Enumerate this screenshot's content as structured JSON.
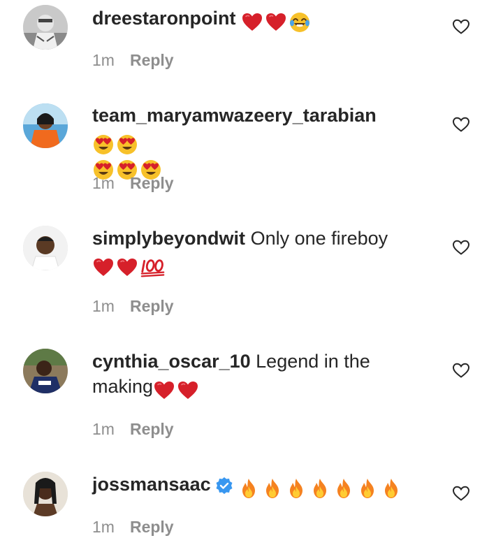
{
  "comments": [
    {
      "username": "dreestaronpoint",
      "text": "",
      "emojis": [
        "heart",
        "heart",
        "joy"
      ],
      "time": "1m",
      "reply": "Reply"
    },
    {
      "username": "team_maryamwazeery_tarabian",
      "text": "",
      "emojis": [
        "heart-eyes",
        "heart-eyes",
        "heart-eyes",
        "heart-eyes",
        "heart-eyes"
      ],
      "time": "1m",
      "reply": "Reply"
    },
    {
      "username": "simplybeyondwit",
      "text": "Only one fireboy",
      "emojis": [
        "heart",
        "heart",
        "hundred"
      ],
      "time": "1m",
      "reply": "Reply"
    },
    {
      "username": "cynthia_oscar_10",
      "text": "Legend in the",
      "text2": "making",
      "emojis": [
        "heart",
        "heart"
      ],
      "time": "1m",
      "reply": "Reply"
    },
    {
      "username": "jossmansaac",
      "verified": true,
      "text": "",
      "emojis": [
        "fire",
        "fire",
        "fire",
        "fire",
        "fire",
        "fire",
        "fire"
      ],
      "time": "1m",
      "reply": "Reply"
    }
  ],
  "icons": {
    "like": "heart-outline-icon",
    "verified": "verified-badge-icon"
  },
  "colors": {
    "text": "#262626",
    "meta": "#8e8e8e",
    "emoji_heart": "#d6202a",
    "verified": "#3897f0"
  }
}
